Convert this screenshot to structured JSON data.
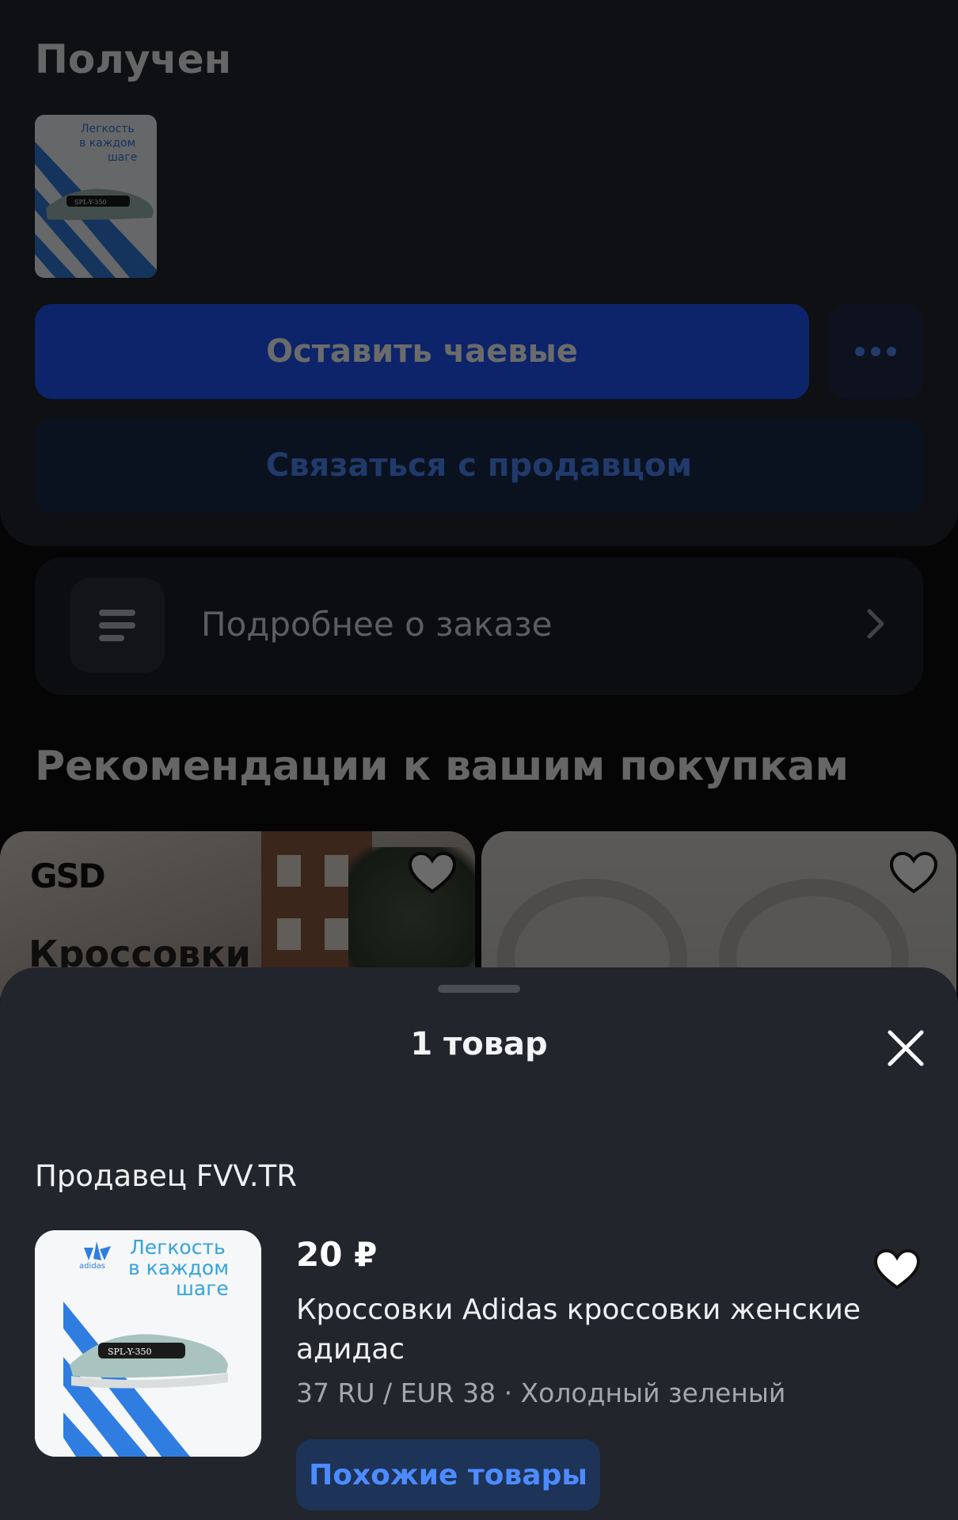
{
  "order": {
    "status": "Получен",
    "tip_button": "Оставить чаевые",
    "contact_button": "Связаться с продавцом",
    "details_label": "Подробнее о заказе"
  },
  "product_art": {
    "line1": "Легкость",
    "line2": "в каждом",
    "line3": "шаге",
    "brand": "adidas",
    "model": "SPL-Y-350"
  },
  "recommendations": {
    "title": "Рекомендации к вашим покупкам",
    "cards": [
      {
        "brand": "GSD",
        "word": "Кроссовки"
      },
      {
        "brand": "",
        "word": ""
      }
    ]
  },
  "sheet": {
    "title": "1 товар",
    "seller": "Продавец FVV.TR",
    "item": {
      "price": "20 ₽",
      "name": "Кроссовки Adidas кроссовки женские адидас",
      "variant": "37 RU / EUR 38 · Холодный зеленый",
      "similar_button": "Похожие товары"
    }
  },
  "colors": {
    "accent": "#1e55ff",
    "link": "#4d8bff",
    "sheet_bg": "#22252c"
  }
}
